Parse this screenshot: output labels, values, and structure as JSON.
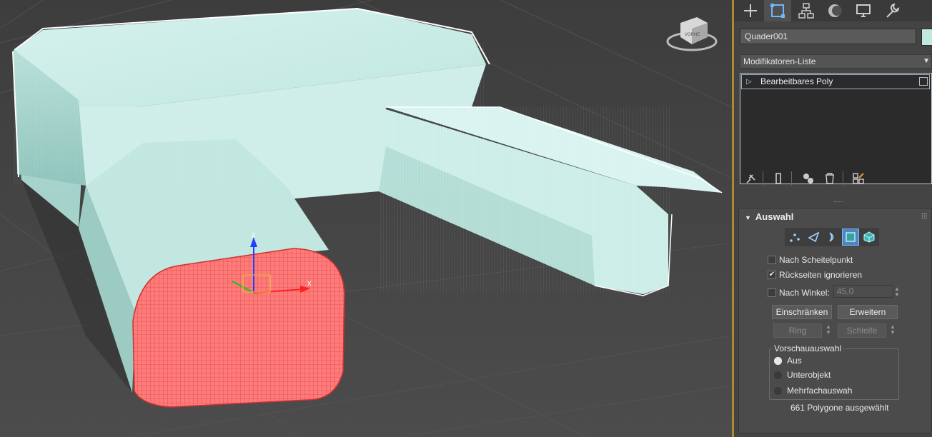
{
  "viewport": {
    "axis_x": "x",
    "axis_z": "z",
    "viewcube_label": "VORNE"
  },
  "tabs": [
    {
      "name": "create-tab",
      "icon": "plus-icon"
    },
    {
      "name": "modify-tab",
      "icon": "modify-icon"
    },
    {
      "name": "hierarchy-tab",
      "icon": "hierarchy-icon"
    },
    {
      "name": "motion-tab",
      "icon": "motion-icon"
    },
    {
      "name": "display-tab",
      "icon": "display-icon"
    },
    {
      "name": "utilities-tab",
      "icon": "wrench-icon"
    }
  ],
  "object_name": "Quader001",
  "object_color": "#bfe8de",
  "modifier_list": "Modifikatoren-Liste",
  "stack": {
    "item": "Bearbeitbares Poly"
  },
  "rollout": {
    "title": "Auswahl",
    "options": {
      "vertex": "Nach Scheitelpunkt",
      "backface": "Rückseiten ignorieren",
      "backface_checked": true,
      "angle": "Nach Winkel:",
      "angle_value": "45,0"
    },
    "buttons": {
      "shrink": "Einschränken",
      "grow": "Erweitern",
      "ring": "Ring",
      "loop": "Schleife"
    },
    "preview": {
      "title": "Vorschauauswahl",
      "off": "Aus",
      "subobject": "Unterobjekt",
      "multi": "Mehrfachauswah"
    },
    "status": "661 Polygone ausgewählt"
  },
  "colors": {
    "accent": "#b08a2a",
    "selected": "#ff7a78",
    "mesh": "#c9ece6",
    "active_button": "#4d86c6"
  }
}
